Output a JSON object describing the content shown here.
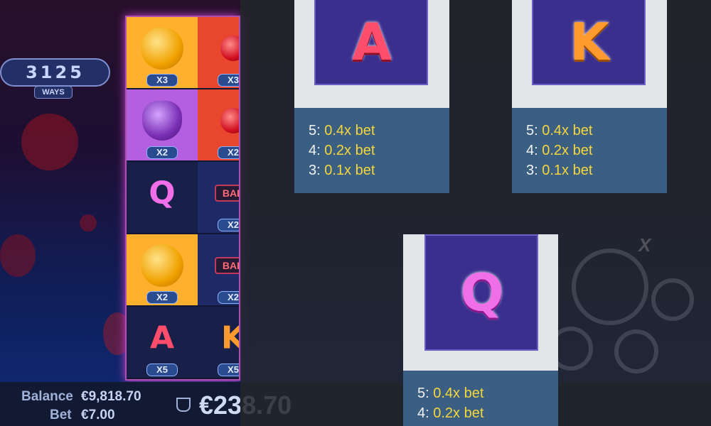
{
  "background": {
    "ways_value": "3125",
    "ways_label": "WAYS",
    "balance_label": "Balance",
    "balance_value": "€9,818.70",
    "bet_label": "Bet",
    "bet_value": "€7.00",
    "win_value": "€238.70",
    "reel_grid": [
      {
        "icon": "orange-icon",
        "mult": "X3"
      },
      {
        "icon": "cherry-icon",
        "mult": "X3"
      },
      {
        "icon": "grapes-icon",
        "mult": "X2"
      },
      {
        "icon": "cherry-icon",
        "mult": "X2"
      },
      {
        "icon": "Q",
        "mult": ""
      },
      {
        "icon": "BAR",
        "mult": "X2"
      },
      {
        "icon": "orange-icon",
        "mult": "X2"
      },
      {
        "icon": "BAR",
        "mult": "X2"
      },
      {
        "icon": "A",
        "mult": "X5"
      },
      {
        "icon": "K",
        "mult": "X5"
      }
    ]
  },
  "paytable": [
    {
      "symbol": "A",
      "lines": [
        {
          "count": "5:",
          "value": "0.4x bet"
        },
        {
          "count": "4:",
          "value": "0.2x bet"
        },
        {
          "count": "3:",
          "value": "0.1x bet"
        }
      ]
    },
    {
      "symbol": "K",
      "lines": [
        {
          "count": "5:",
          "value": "0.4x bet"
        },
        {
          "count": "4:",
          "value": "0.2x bet"
        },
        {
          "count": "3:",
          "value": "0.1x bet"
        }
      ]
    },
    {
      "symbol": "Q",
      "lines": [
        {
          "count": "5:",
          "value": "0.4x bet"
        },
        {
          "count": "4:",
          "value": "0.2x bet"
        }
      ]
    }
  ],
  "colors": {
    "pay_value": "#f5d63b",
    "pay_panel": "#3a5f82",
    "card": "#3a2f8d"
  }
}
